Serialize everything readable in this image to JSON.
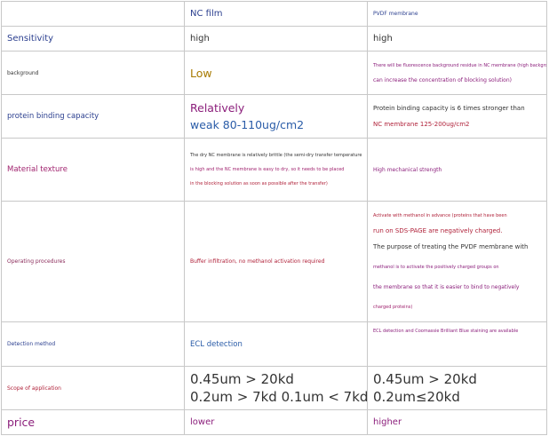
{
  "header": {
    "col1": "",
    "col2": "NC film",
    "col3": "PVDF membrane"
  },
  "rows": {
    "sensitivity": {
      "label": "Sensitivity",
      "nc": "high",
      "pvdf": "high"
    },
    "background": {
      "label": "background",
      "nc": "Low",
      "pvdf": [
        "There will be fluorescence background residue in NC membrane (high background",
        "can increase the concentration of blocking solution)"
      ]
    },
    "binding": {
      "label": "protein binding capacity",
      "nc": [
        "Relatively",
        "weak 80-110ug/cm2"
      ],
      "pvdf": [
        "Protein binding capacity is 6 times stronger than",
        "NC membrane 125-200ug/cm2"
      ]
    },
    "texture": {
      "label": "Material texture",
      "nc": [
        "The dry NC membrane is relatively brittle (the semi-dry transfer temperature",
        "is high and the NC membrane is easy to dry, so it needs to be placed",
        "in the blocking solution as soon as possible after the transfer)"
      ],
      "pvdf": "High mechanical strength"
    },
    "procedures": {
      "label": "Operating procedures",
      "nc": "Buffer infiltration, no methanol activation required",
      "pvdf": [
        "Activate with methanol in advance (proteins that have been",
        "run on SDS-PAGE are negatively charged.",
        "The purpose of treating the PVDF membrane with",
        "methanol is to activate the positively charged groups on",
        "the membrane so that it is easier to bind to negatively",
        "charged proteins)"
      ]
    },
    "detection": {
      "label": "Detection method",
      "nc": "ECL detection",
      "pvdf": "ECL detection and Coomassie Brilliant Blue staining are available"
    },
    "scope": {
      "label": "Scope of application",
      "nc": [
        "0.45um > 20kd",
        "0.2um > 7kd 0.1um < 7kd"
      ],
      "pvdf": [
        "0.45um > 20kd",
        "0.2um≤20kd"
      ]
    },
    "price": {
      "label": "price",
      "nc": "lower",
      "pvdf": "higher"
    }
  }
}
